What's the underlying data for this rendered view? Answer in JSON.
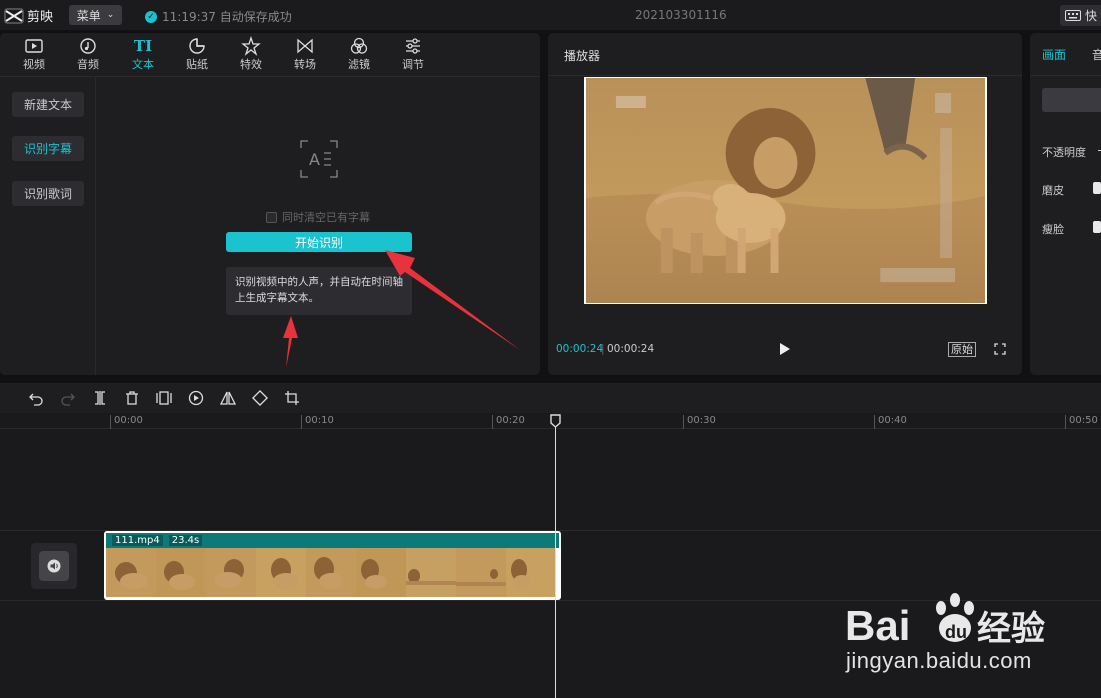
{
  "app": {
    "name": "剪映",
    "menu_label": "菜单",
    "save_status": "11:19:37 自动保存成功",
    "project_name": "202103301116",
    "shortcut_label": "快"
  },
  "toolbar": {
    "tabs": [
      {
        "label": "视频",
        "icon": "video-icon"
      },
      {
        "label": "音频",
        "icon": "audio-icon"
      },
      {
        "label": "文本",
        "icon": "text-icon",
        "glyph": "TI",
        "active": true
      },
      {
        "label": "贴纸",
        "icon": "sticker-icon"
      },
      {
        "label": "特效",
        "icon": "effects-icon"
      },
      {
        "label": "转场",
        "icon": "transition-icon"
      },
      {
        "label": "滤镜",
        "icon": "filter-icon"
      },
      {
        "label": "调节",
        "icon": "adjust-icon"
      }
    ]
  },
  "text_sidebar": {
    "items": [
      {
        "label": "新建文本"
      },
      {
        "label": "识别字幕",
        "active": true
      },
      {
        "label": "识别歌词"
      }
    ]
  },
  "recognition": {
    "clear_existing_label": "同时清空已有字幕",
    "start_button": "开始识别",
    "description": "识别视频中的人声，并自动在时间轴上生成字幕文本。"
  },
  "player": {
    "title": "播放器",
    "current_time": "00:00:24",
    "total_time": "00:00:24",
    "ratio_label": "原始"
  },
  "properties": {
    "tab_1": "画面",
    "tab_2": "音",
    "rows": [
      {
        "label": "不透明度"
      },
      {
        "label": "磨皮"
      },
      {
        "label": "瘦脸"
      }
    ]
  },
  "timeline": {
    "ruler_ticks": [
      "00:00",
      "00:10",
      "00:20",
      "00:30",
      "00:40",
      "00:50"
    ],
    "clip": {
      "filename": "111.mp4",
      "duration": "23.4s"
    }
  },
  "colors": {
    "accent": "#1bc3cf",
    "clip_header": "#0d7a7a",
    "annotation_arrow": "#e8323c"
  },
  "watermark": {
    "brand": "Bai du 经验",
    "url": "jingyan.baidu.com"
  }
}
